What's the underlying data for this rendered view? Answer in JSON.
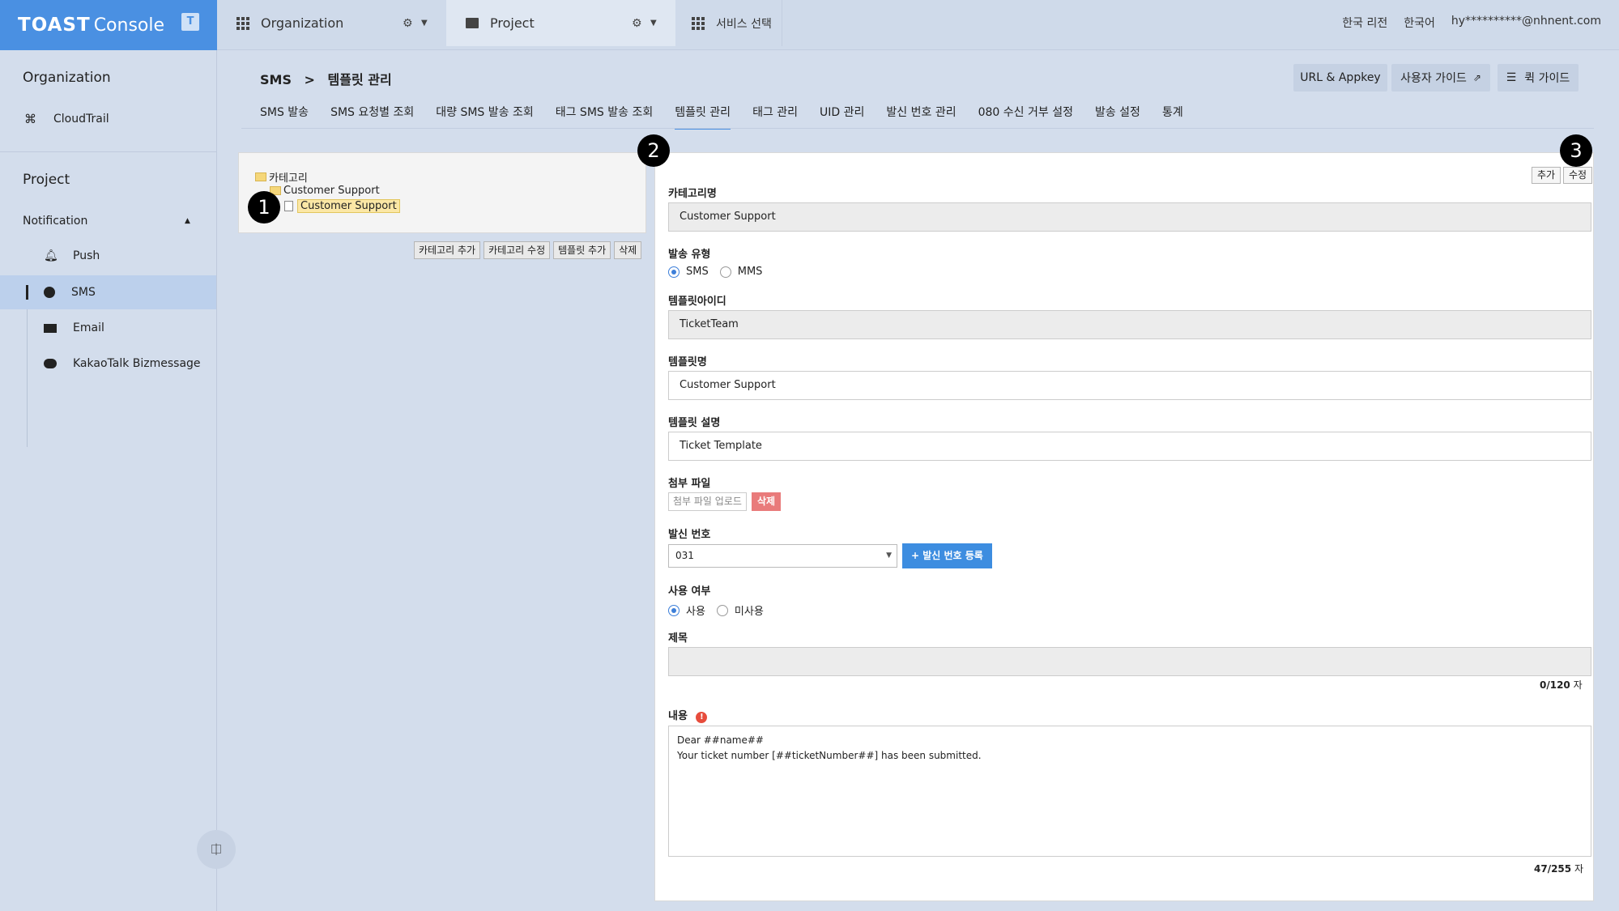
{
  "topbar": {
    "brand": "TOAST",
    "console": "Console",
    "org_tab": "Organization",
    "project_tab": "Project",
    "service_tab": "서비스 선택",
    "region": "한국 리전",
    "language": "한국어",
    "user": "hy**********@nhnent.com"
  },
  "sidebar": {
    "org_title": "Organization",
    "cloudtrail": "CloudTrail",
    "project_title": "Project",
    "notification": "Notification",
    "items": [
      "Push",
      "SMS",
      "Email",
      "KakaoTalk Bizmessage"
    ],
    "active": "SMS"
  },
  "header": {
    "breadcrumb_root": "SMS",
    "breadcrumb_sep": ">",
    "breadcrumb_page": "템플릿 관리",
    "btn_url_appkey": "URL & Appkey",
    "btn_user_guide": "사용자 가이드",
    "btn_quick_guide": "퀵 가이드"
  },
  "tabs": [
    "SMS 발송",
    "SMS 요청별 조회",
    "대량 SMS 발송 조회",
    "태그 SMS 발송 조회",
    "템플릿 관리",
    "태그 관리",
    "UID 관리",
    "발신 번호 관리",
    "080 수신 거부 설정",
    "발송 설정",
    "통계"
  ],
  "active_tab": "템플릿 관리",
  "tree": {
    "root": "카테고리",
    "category": "Customer Support",
    "template": "Customer Support",
    "buttons": [
      "카테고리 추가",
      "카테고리 수정",
      "템플릿 추가",
      "삭제"
    ]
  },
  "markers": [
    "1",
    "2",
    "3"
  ],
  "form": {
    "btn_add": "추가",
    "btn_edit": "수정",
    "category_label": "카테고리명",
    "category_value": "Customer Support",
    "send_type_label": "발송 유형",
    "send_type_options": [
      "SMS",
      "MMS"
    ],
    "send_type_selected": "SMS",
    "template_id_label": "템플릿아이디",
    "template_id_value": "TicketTeam",
    "template_name_label": "템플릿명",
    "template_name_value": "Customer Support",
    "template_desc_label": "템플릿 설명",
    "template_desc_value": "Ticket Template",
    "attach_label": "첨부 파일",
    "attach_upload": "첨부 파일 업로드",
    "attach_delete": "삭제",
    "sender_label": "발신 번호",
    "sender_value": "031",
    "sender_register": "+ 발신 번호 등록",
    "use_label": "사용 여부",
    "use_options": [
      "사용",
      "미사용"
    ],
    "use_selected": "사용",
    "title_label": "제목",
    "title_value": "",
    "title_count": "0/120",
    "title_count_unit": "자",
    "content_label": "내용",
    "content_line1": "Dear ##name##",
    "content_line2": "Your ticket number [##ticketNumber##] has been submitted.",
    "content_count": "47/255",
    "content_count_unit": "자"
  },
  "colors": {
    "brand_blue": "#4a90e2",
    "background": "#d3ddec",
    "delete_red": "#e97b7b",
    "register_blue": "#3d8de0"
  }
}
